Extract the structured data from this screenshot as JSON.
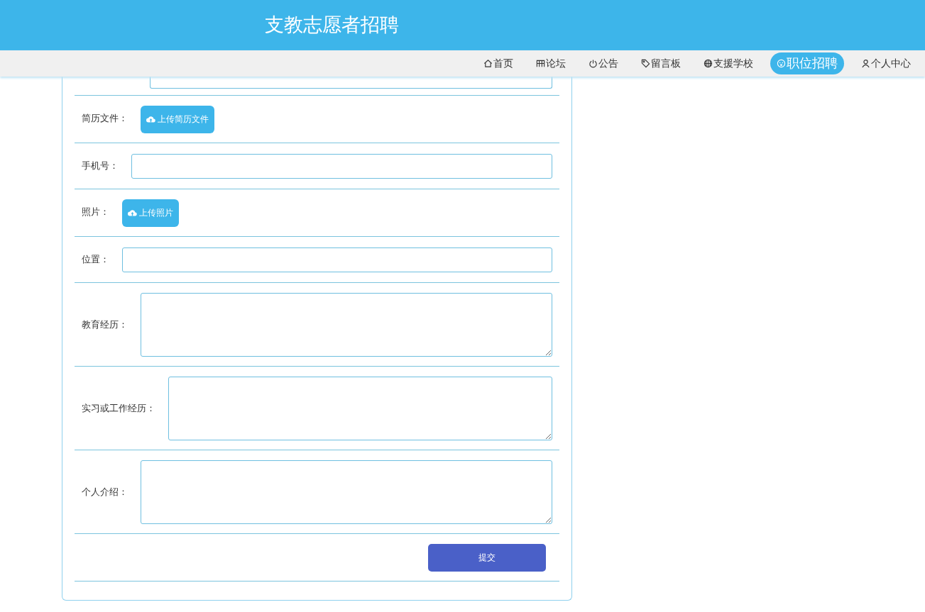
{
  "header": {
    "title": "支教志愿者招聘"
  },
  "nav": [
    {
      "label": "首页",
      "selected": false
    },
    {
      "label": "论坛",
      "selected": false
    },
    {
      "label": "公告",
      "selected": false
    },
    {
      "label": "留言板",
      "selected": false
    },
    {
      "label": "支援学校",
      "selected": false
    },
    {
      "label": "职位招聘",
      "selected": true
    },
    {
      "label": "个人中心",
      "selected": false
    }
  ],
  "form": {
    "fields": [
      {
        "kind": "input",
        "partial": true
      },
      {
        "kind": "upload",
        "label": "简历文件：",
        "button": "上传简历文件"
      },
      {
        "kind": "input",
        "label": "手机号："
      },
      {
        "kind": "upload",
        "label": "照片：",
        "button": "上传照片"
      },
      {
        "kind": "input",
        "label": "位置："
      },
      {
        "kind": "textarea",
        "label": "教育经历："
      },
      {
        "kind": "textarea",
        "label": "实习或工作经历："
      },
      {
        "kind": "textarea",
        "label": "个人介绍："
      }
    ],
    "submit": "提交"
  }
}
